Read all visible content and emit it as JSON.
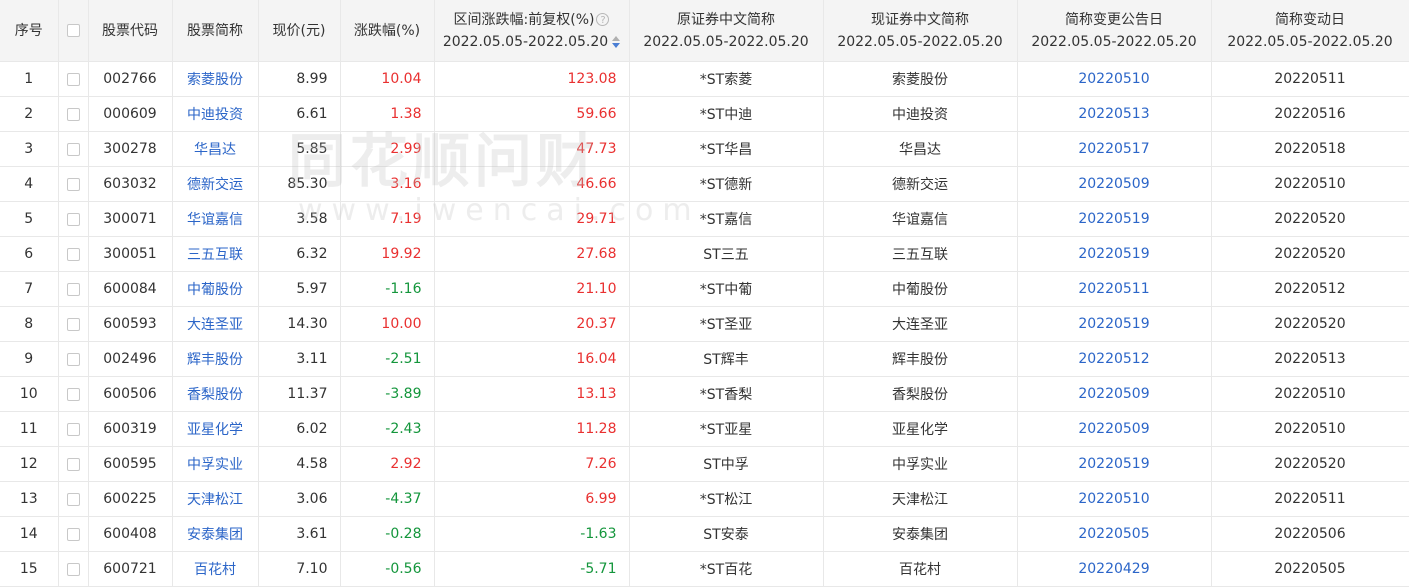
{
  "watermark": {
    "brand": "同花顺问财",
    "url": "www.iwencai.com"
  },
  "headers": {
    "index": "序号",
    "code": "股票代码",
    "name": "股票简称",
    "price": "现价(元)",
    "change": "涨跌幅(%)",
    "range_change": "区间涨跌幅:前复权(%)",
    "range_change_period": "2022.05.05-2022.05.20",
    "orig_name": "原证券中文简称",
    "orig_name_period": "2022.05.05-2022.05.20",
    "cur_name": "现证券中文简称",
    "cur_name_period": "2022.05.05-2022.05.20",
    "notice_date": "简称变更公告日",
    "notice_date_period": "2022.05.05-2022.05.20",
    "change_date": "简称变动日",
    "change_date_period": "2022.05.05-2022.05.20"
  },
  "icons": {
    "help": "question-circle-icon",
    "sort": "sort-icon",
    "checkbox": "checkbox"
  },
  "colors": {
    "up": "#e93030",
    "down": "#14963c",
    "link": "#2b65c8",
    "header_bg": "#f4f4f4",
    "border": "#e8e8e8"
  },
  "rows": [
    {
      "idx": "1",
      "code": "002766",
      "name": "索菱股份",
      "price": "8.99",
      "chg": "10.04",
      "range": "123.08",
      "orig": "*ST索菱",
      "cur": "索菱股份",
      "notice": "20220510",
      "date": "20220511"
    },
    {
      "idx": "2",
      "code": "000609",
      "name": "中迪投资",
      "price": "6.61",
      "chg": "1.38",
      "range": "59.66",
      "orig": "*ST中迪",
      "cur": "中迪投资",
      "notice": "20220513",
      "date": "20220516"
    },
    {
      "idx": "3",
      "code": "300278",
      "name": "华昌达",
      "price": "5.85",
      "chg": "2.99",
      "range": "47.73",
      "orig": "*ST华昌",
      "cur": "华昌达",
      "notice": "20220517",
      "date": "20220518"
    },
    {
      "idx": "4",
      "code": "603032",
      "name": "德新交运",
      "price": "85.30",
      "chg": "3.16",
      "range": "46.66",
      "orig": "*ST德新",
      "cur": "德新交运",
      "notice": "20220509",
      "date": "20220510"
    },
    {
      "idx": "5",
      "code": "300071",
      "name": "华谊嘉信",
      "price": "3.58",
      "chg": "7.19",
      "range": "29.71",
      "orig": "*ST嘉信",
      "cur": "华谊嘉信",
      "notice": "20220519",
      "date": "20220520"
    },
    {
      "idx": "6",
      "code": "300051",
      "name": "三五互联",
      "price": "6.32",
      "chg": "19.92",
      "range": "27.68",
      "orig": "ST三五",
      "cur": "三五互联",
      "notice": "20220519",
      "date": "20220520"
    },
    {
      "idx": "7",
      "code": "600084",
      "name": "中葡股份",
      "price": "5.97",
      "chg": "-1.16",
      "range": "21.10",
      "orig": "*ST中葡",
      "cur": "中葡股份",
      "notice": "20220511",
      "date": "20220512"
    },
    {
      "idx": "8",
      "code": "600593",
      "name": "大连圣亚",
      "price": "14.30",
      "chg": "10.00",
      "range": "20.37",
      "orig": "*ST圣亚",
      "cur": "大连圣亚",
      "notice": "20220519",
      "date": "20220520"
    },
    {
      "idx": "9",
      "code": "002496",
      "name": "辉丰股份",
      "price": "3.11",
      "chg": "-2.51",
      "range": "16.04",
      "orig": "ST辉丰",
      "cur": "辉丰股份",
      "notice": "20220512",
      "date": "20220513"
    },
    {
      "idx": "10",
      "code": "600506",
      "name": "香梨股份",
      "price": "11.37",
      "chg": "-3.89",
      "range": "13.13",
      "orig": "*ST香梨",
      "cur": "香梨股份",
      "notice": "20220509",
      "date": "20220510"
    },
    {
      "idx": "11",
      "code": "600319",
      "name": "亚星化学",
      "price": "6.02",
      "chg": "-2.43",
      "range": "11.28",
      "orig": "*ST亚星",
      "cur": "亚星化学",
      "notice": "20220509",
      "date": "20220510"
    },
    {
      "idx": "12",
      "code": "600595",
      "name": "中孚实业",
      "price": "4.58",
      "chg": "2.92",
      "range": "7.26",
      "orig": "ST中孚",
      "cur": "中孚实业",
      "notice": "20220519",
      "date": "20220520"
    },
    {
      "idx": "13",
      "code": "600225",
      "name": "天津松江",
      "price": "3.06",
      "chg": "-4.37",
      "range": "6.99",
      "orig": "*ST松江",
      "cur": "天津松江",
      "notice": "20220510",
      "date": "20220511"
    },
    {
      "idx": "14",
      "code": "600408",
      "name": "安泰集团",
      "price": "3.61",
      "chg": "-0.28",
      "range": "-1.63",
      "orig": "ST安泰",
      "cur": "安泰集团",
      "notice": "20220505",
      "date": "20220506"
    },
    {
      "idx": "15",
      "code": "600721",
      "name": "百花村",
      "price": "7.10",
      "chg": "-0.56",
      "range": "-5.71",
      "orig": "*ST百花",
      "cur": "百花村",
      "notice": "20220429",
      "date": "20220505"
    }
  ]
}
